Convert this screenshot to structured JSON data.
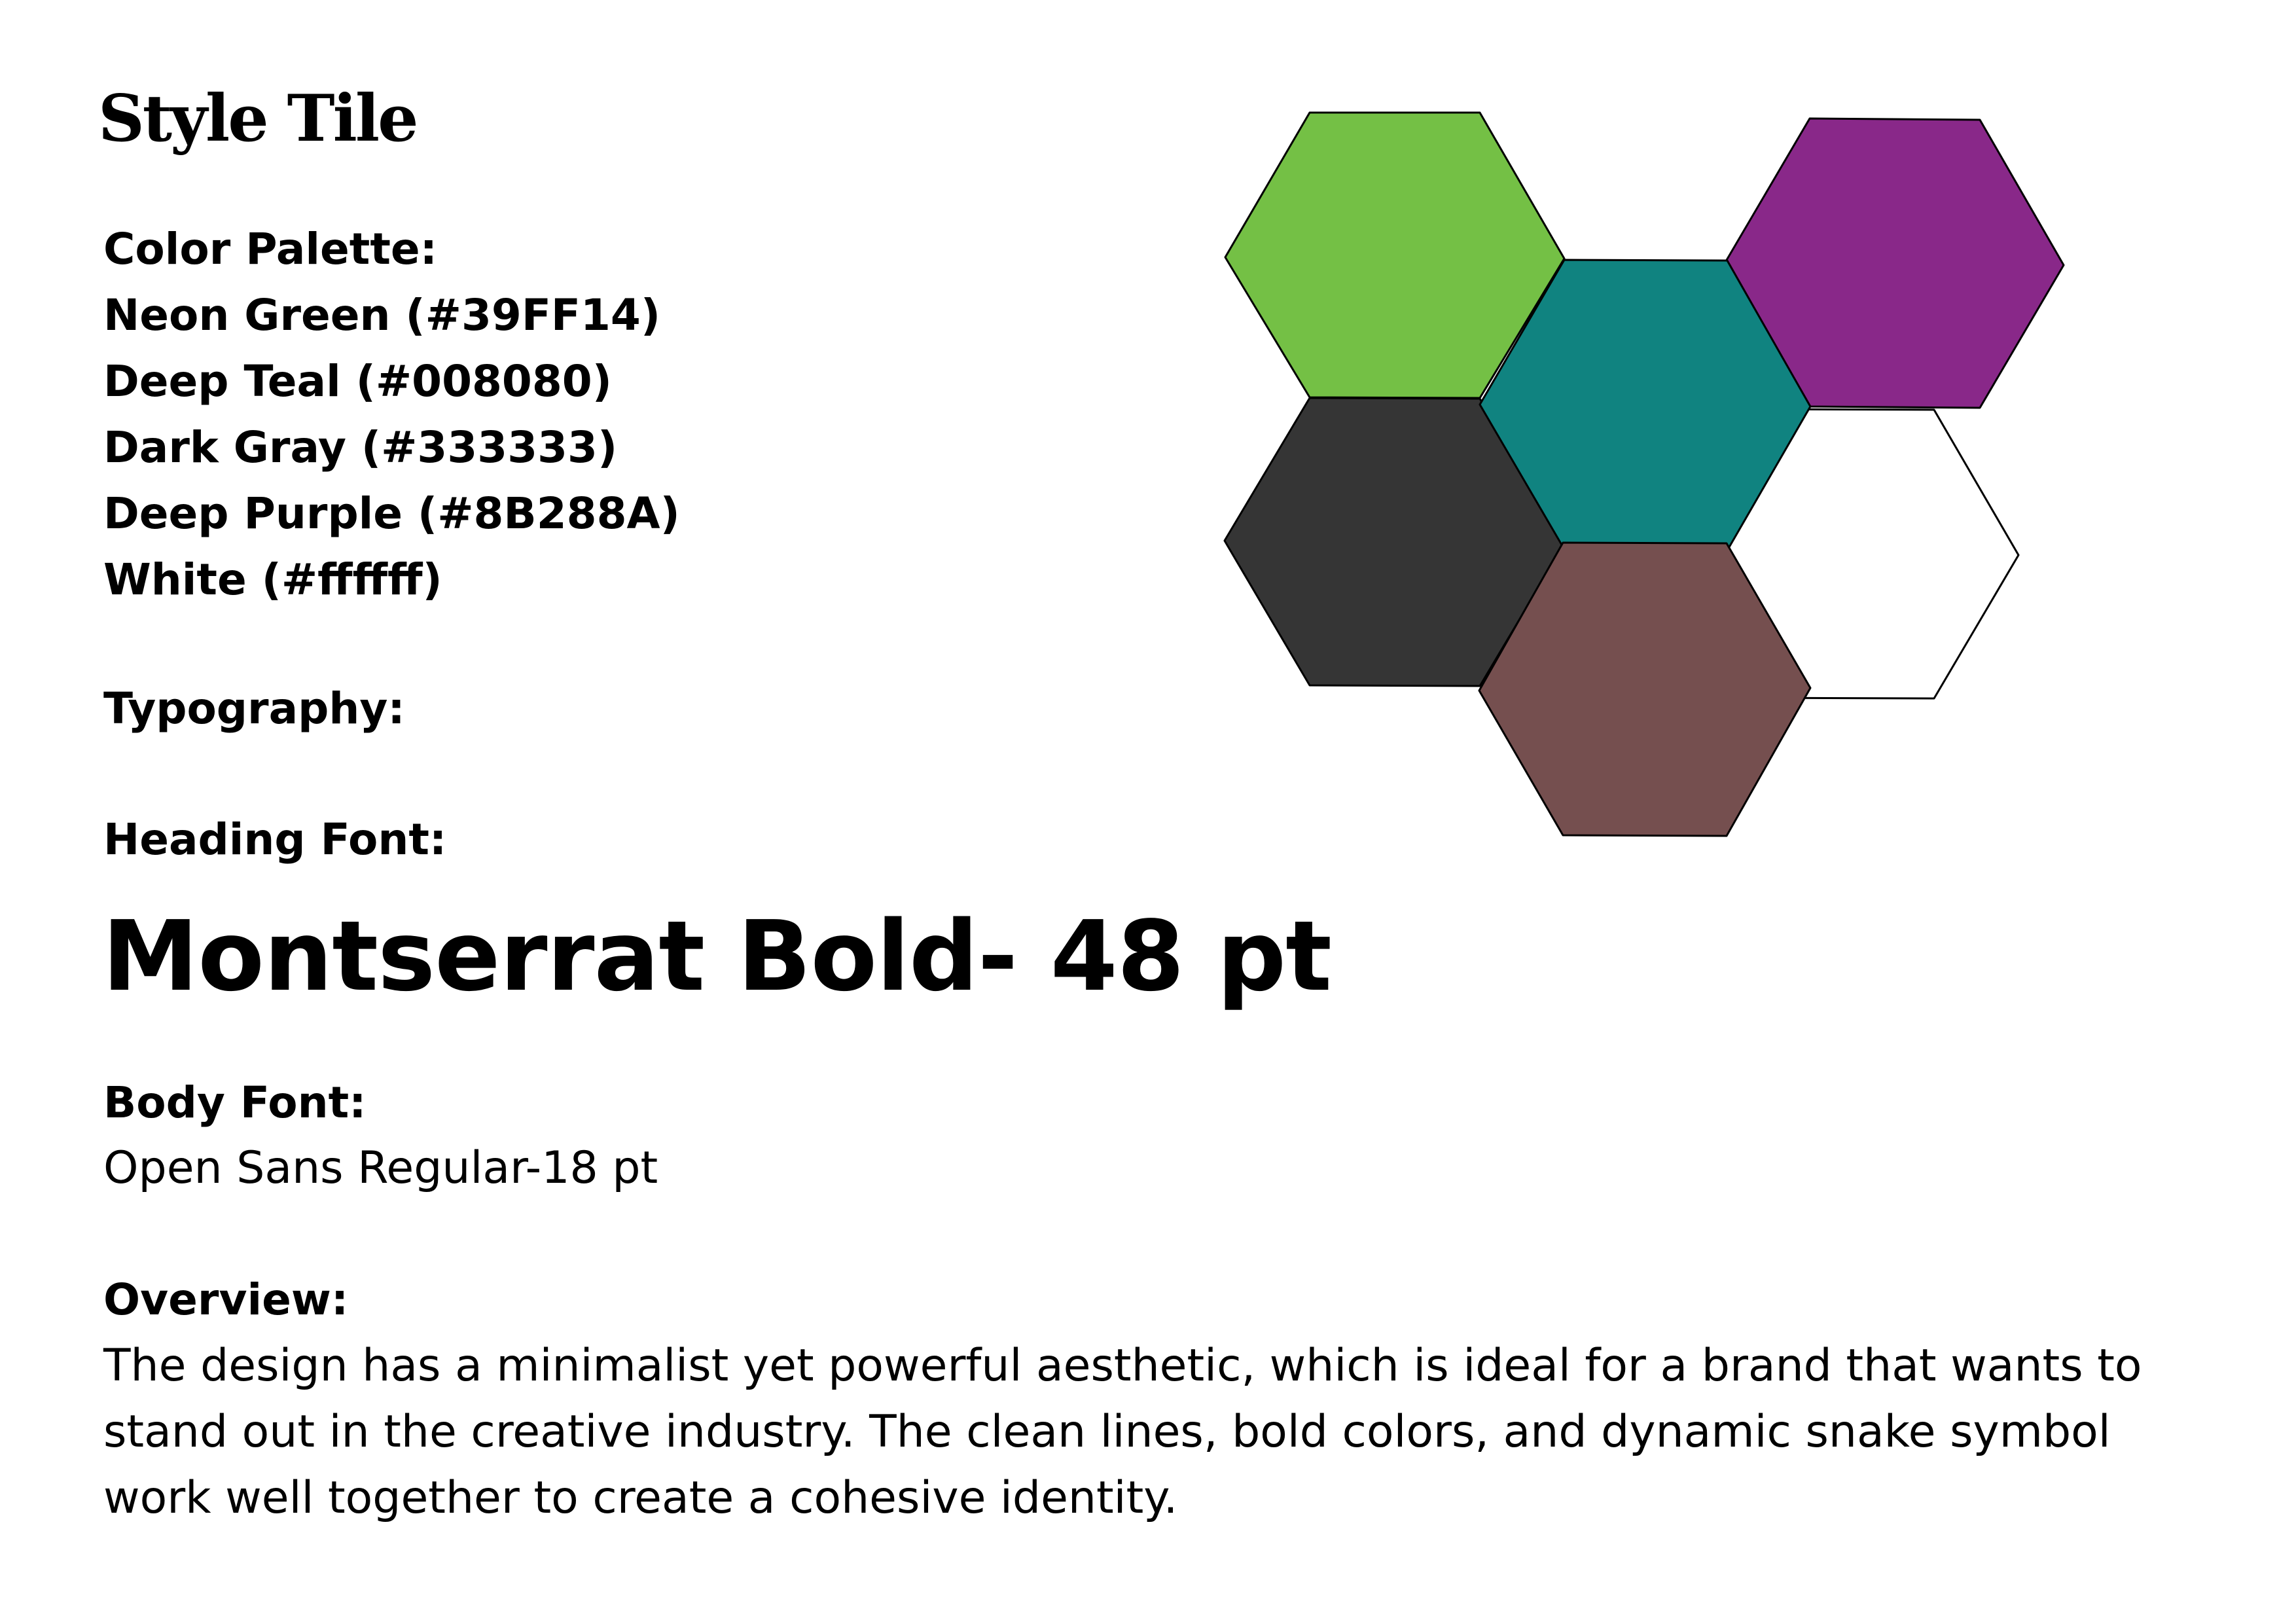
{
  "page": {
    "title": "Style Tile"
  },
  "color_palette": {
    "label": "Color Palette:",
    "items": [
      {
        "text": "Neon Green (#39FF14)"
      },
      {
        "text": "Deep Teal (#008080)"
      },
      {
        "text": "Dark Gray (#333333)"
      },
      {
        "text": "Deep Purple (#8B288A)"
      },
      {
        "text": "White (#ffffff)"
      }
    ]
  },
  "typography": {
    "label": "Typography:",
    "heading_label": "Heading Font:",
    "heading_sample": "Montserrat Bold- 48 pt",
    "body_label": "Body Font:",
    "body_sample": "Open Sans Regular-18 pt"
  },
  "overview": {
    "label": "Overview:",
    "text": "The design has a minimalist yet powerful aesthetic, which is ideal for a brand that wants to stand out in the creative industry. The clean lines, bold colors, and dynamic snake symbol work well together to create a cohesive identity."
  },
  "swatches": {
    "green": "#74C045",
    "teal": "#108380",
    "purple": "#892889",
    "dark_gray": "#353535",
    "white": "#FFFFFF",
    "brown": "#754F4F"
  }
}
